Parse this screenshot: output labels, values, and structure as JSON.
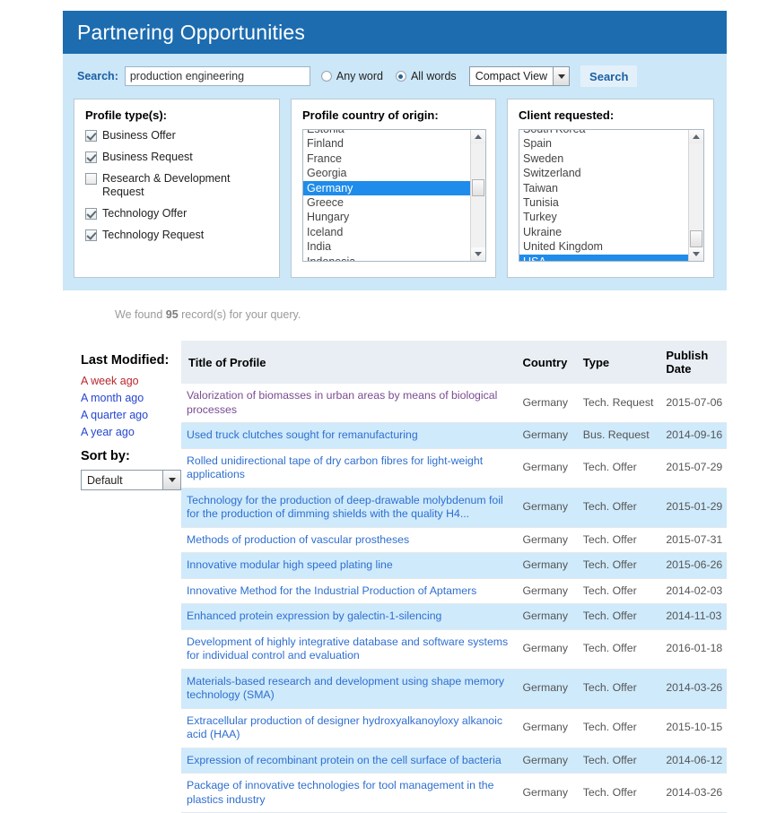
{
  "header": {
    "title": "Partnering Opportunities"
  },
  "search": {
    "label": "Search:",
    "value": "production engineering",
    "placeholder": "",
    "match_options": [
      {
        "label": "Any word",
        "selected": false
      },
      {
        "label": "All words",
        "selected": true
      }
    ],
    "view_mode": "Compact View",
    "button_label": "Search"
  },
  "filters": {
    "profile_types": {
      "title": "Profile type(s):",
      "items": [
        {
          "label": "Business Offer",
          "checked": true
        },
        {
          "label": "Business Request",
          "checked": true
        },
        {
          "label": "Research & Development Request",
          "checked": false
        },
        {
          "label": "Technology Offer",
          "checked": true
        },
        {
          "label": "Technology Request",
          "checked": true
        }
      ]
    },
    "country_of_origin": {
      "title": "Profile country of origin:",
      "options": [
        {
          "label": "Estonia",
          "selected": false
        },
        {
          "label": "Finland",
          "selected": false
        },
        {
          "label": "France",
          "selected": false
        },
        {
          "label": "Georgia",
          "selected": false
        },
        {
          "label": "Germany",
          "selected": true
        },
        {
          "label": "Greece",
          "selected": false
        },
        {
          "label": "Hungary",
          "selected": false
        },
        {
          "label": "Iceland",
          "selected": false
        },
        {
          "label": "India",
          "selected": false
        },
        {
          "label": "Indonesia",
          "selected": false
        }
      ]
    },
    "client_requested": {
      "title": "Client requested:",
      "options": [
        {
          "label": "South Korea",
          "selected": false
        },
        {
          "label": "Spain",
          "selected": false
        },
        {
          "label": "Sweden",
          "selected": false
        },
        {
          "label": "Switzerland",
          "selected": false
        },
        {
          "label": "Taiwan",
          "selected": false
        },
        {
          "label": "Tunisia",
          "selected": false
        },
        {
          "label": "Turkey",
          "selected": false
        },
        {
          "label": "Ukraine",
          "selected": false
        },
        {
          "label": "United Kingdom",
          "selected": false
        },
        {
          "label": "USA",
          "selected": true
        }
      ]
    }
  },
  "results_summary": {
    "prefix": "We found ",
    "count": "95",
    "suffix": " record(s) for your query."
  },
  "sidebar": {
    "last_modified_title": "Last Modified:",
    "last_modified_links": [
      {
        "label": "A week ago",
        "active": true
      },
      {
        "label": "A month ago",
        "active": false
      },
      {
        "label": "A quarter ago",
        "active": false
      },
      {
        "label": "A year ago",
        "active": false
      }
    ],
    "sort_by_title": "Sort by:",
    "sort_value": "Default"
  },
  "table": {
    "columns": [
      "Title of Profile",
      "Country",
      "Type",
      "Publish Date"
    ],
    "rows": [
      {
        "title": "Valorization  of biomasses in urban areas by means of biological processes",
        "country": "Germany",
        "type": "Tech. Request",
        "date": "2015-07-06",
        "visited": true
      },
      {
        "title": "Used truck clutches sought for remanufacturing",
        "country": "Germany",
        "type": "Bus. Request",
        "date": "2014-09-16",
        "visited": false
      },
      {
        "title": "Rolled unidirectional tape of dry carbon fibres for light-weight applications",
        "country": "Germany",
        "type": "Tech. Offer",
        "date": "2015-07-29",
        "visited": false
      },
      {
        "title": "Technology for the production of deep-drawable molybdenum foil for the production of dimming shields with the quality H4...",
        "country": "Germany",
        "type": "Tech. Offer",
        "date": "2015-01-29",
        "visited": false
      },
      {
        "title": "Methods of production of vascular prostheses",
        "country": "Germany",
        "type": "Tech. Offer",
        "date": "2015-07-31",
        "visited": false
      },
      {
        "title": "Innovative modular high speed plating line",
        "country": "Germany",
        "type": "Tech. Offer",
        "date": "2015-06-26",
        "visited": false
      },
      {
        "title": "Innovative Method for the Industrial Production of Aptamers",
        "country": "Germany",
        "type": "Tech. Offer",
        "date": "2014-02-03",
        "visited": false
      },
      {
        "title": "Enhanced protein expression by galectin-1-silencing",
        "country": "Germany",
        "type": "Tech. Offer",
        "date": "2014-11-03",
        "visited": false
      },
      {
        "title": "Development of highly integrative database and software systems for individual control and evaluation",
        "country": "Germany",
        "type": "Tech. Offer",
        "date": "2016-01-18",
        "visited": false
      },
      {
        "title": "Materials-based research and development using shape memory technology (SMA)",
        "country": "Germany",
        "type": "Tech. Offer",
        "date": "2014-03-26",
        "visited": false
      },
      {
        "title": "Extracellular production of designer hydroxyalkanoyloxy alkanoic acid (HAA)",
        "country": "Germany",
        "type": "Tech. Offer",
        "date": "2015-10-15",
        "visited": false
      },
      {
        "title": "Expression of recombinant protein on the cell surface of bacteria",
        "country": "Germany",
        "type": "Tech. Offer",
        "date": "2014-06-12",
        "visited": false
      },
      {
        "title": "Package of innovative  technologies for tool management in the plastics industry",
        "country": "Germany",
        "type": "Tech. Offer",
        "date": "2014-03-26",
        "visited": false
      }
    ]
  },
  "colors": {
    "header_blue": "#1d6cb0",
    "panel_blue": "#cce7f7",
    "selection_blue": "#1f8ceb",
    "row_alt_blue": "#cfeafb",
    "link_blue": "#2f6fd0",
    "visited_purple": "#7a4b92",
    "active_red": "#b8272d"
  }
}
